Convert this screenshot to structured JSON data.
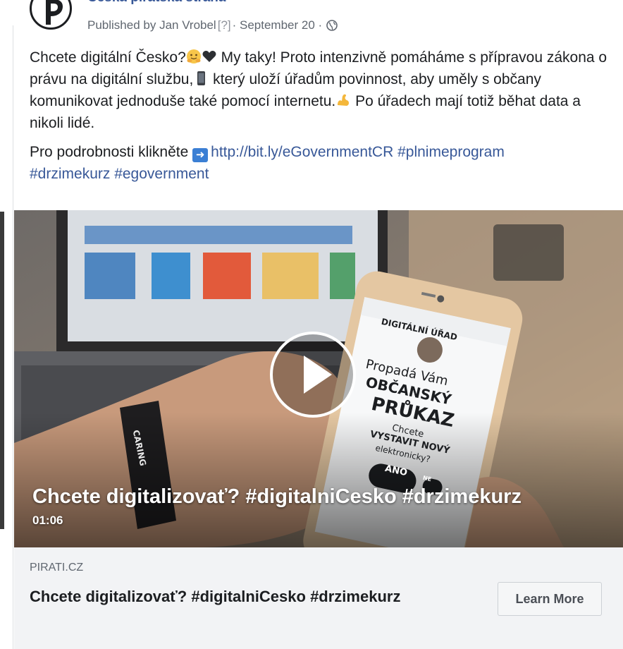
{
  "post": {
    "page_name": "Česká pirátská strana",
    "published_by": "Published by Jan Vrobel",
    "help_marker": "[?]",
    "date": "· September 20 ·",
    "audience_icon": "globe-icon",
    "text_line1": "Chcete digitální Česko?",
    "text_line1b": " My taky! Proto intenzivně pomáháme s přípravou zákona o právu na digitální službu,",
    "text_line1c": "  který uloží úřadům povinnost, aby uměly s občany komunikovat jednoduše také pomocí internetu.",
    "text_line1d": " Po úřadech mají totiž běhat data a nikoli lidé.",
    "text_line2": "Pro podrobnosti klikněte",
    "link_url": "http://bit.ly/eGovernmentCR",
    "hashtags_inline": " #plnimeprogram",
    "hashtags_line": "#drzimekurz #egovernment"
  },
  "video": {
    "title": "Chcete digitalizovať? #digitalniCesko #drzimekurz",
    "duration": "01:06",
    "play_icon": "play-icon",
    "phone_header": "DIGITÁLNÍ ÚŘAD",
    "phone_line1": "Propadá Vám",
    "phone_line2": "OBČANSKÝ",
    "phone_line3": "PRŮKAZ",
    "phone_line4": "Chcete",
    "phone_line5": "VYSTAVIT NOVÝ",
    "phone_line6": "elektronicky?",
    "phone_yes": "ANO",
    "phone_no": "NE",
    "wristband": "CARING"
  },
  "link_preview": {
    "domain": "PIRATI.CZ",
    "title": "Chcete digitalizovať? #digitalniCesko #drzimekurz",
    "button_label": "Learn More"
  },
  "colors": {
    "link": "#385898",
    "text": "#1c1e21",
    "meta": "#606770",
    "footer_bg": "#f2f3f5"
  }
}
